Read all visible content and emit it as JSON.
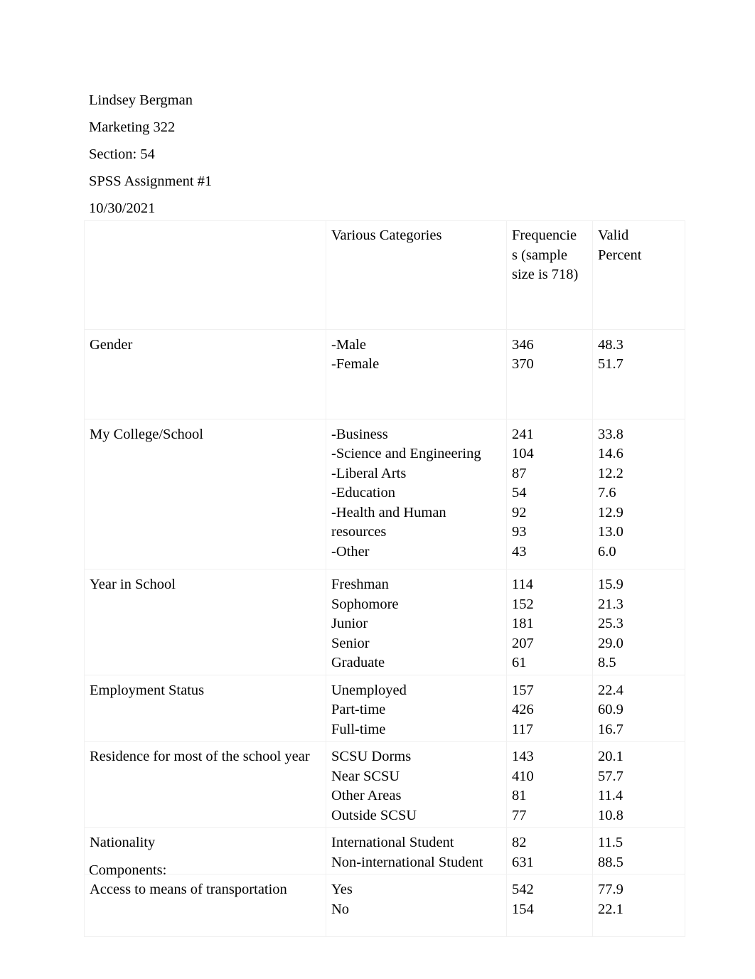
{
  "document": {
    "header_lines": [
      "Lindsey Bergman",
      "Marketing 322",
      "Section: 54",
      "SPSS Assignment #1",
      "10/30/2021"
    ],
    "footer_text": "Components:"
  },
  "table": {
    "headers": {
      "col_label": "",
      "col_categories": "Various Categories",
      "col_frequencies": "Frequencies (sample size is 718)",
      "col_frequencies_lines": [
        "Frequencie",
        "s (sample",
        "size is 718)"
      ],
      "col_valid_percent": "Valid Percent",
      "col_valid_percent_lines": [
        "Valid",
        "Percent"
      ]
    },
    "sample_size": 718,
    "rows": [
      {
        "label": "Gender",
        "categories": [
          "-Male",
          "-Female"
        ],
        "frequencies": [
          "346",
          "370"
        ],
        "valid_percent": [
          "48.3",
          "51.7"
        ]
      },
      {
        "label": "My College/School",
        "categories": [
          "-Business",
          "-Science and Engineering",
          "-Liberal Arts",
          "-Education",
          "-Health and Human",
          "resources",
          "-Other"
        ],
        "frequencies": [
          "241",
          "104",
          "87",
          "54",
          "92",
          "93",
          "43"
        ],
        "valid_percent": [
          "33.8",
          "14.6",
          "12.2",
          "7.6",
          "12.9",
          "13.0",
          "6.0"
        ]
      },
      {
        "label": "Year in School",
        "categories": [
          "Freshman",
          "Sophomore",
          "Junior",
          "Senior",
          "Graduate"
        ],
        "frequencies": [
          "114",
          "152",
          "181",
          "207",
          "61"
        ],
        "valid_percent": [
          "15.9",
          "21.3",
          "25.3",
          "29.0",
          "8.5"
        ]
      },
      {
        "label": "Employment Status",
        "categories": [
          "Unemployed",
          "Part-time",
          "Full-time"
        ],
        "frequencies": [
          "157",
          "426",
          "117"
        ],
        "valid_percent": [
          "22.4",
          "60.9",
          "16.7"
        ]
      },
      {
        "label": "Residence for most of the school year",
        "categories": [
          "SCSU Dorms",
          "Near SCSU",
          "Other Areas",
          "Outside SCSU"
        ],
        "frequencies": [
          "143",
          "410",
          "81",
          "77"
        ],
        "valid_percent": [
          "20.1",
          "57.7",
          "11.4",
          "10.8"
        ]
      },
      {
        "label": "Nationality",
        "categories": [
          "International Student",
          "Non-international Student"
        ],
        "frequencies": [
          "82",
          "631"
        ],
        "valid_percent": [
          "11.5",
          "88.5"
        ]
      },
      {
        "label": "Access to means of transportation",
        "categories": [
          "Yes",
          "No"
        ],
        "frequencies": [
          "542",
          "154"
        ],
        "valid_percent": [
          "77.9",
          "22.1"
        ]
      }
    ]
  }
}
